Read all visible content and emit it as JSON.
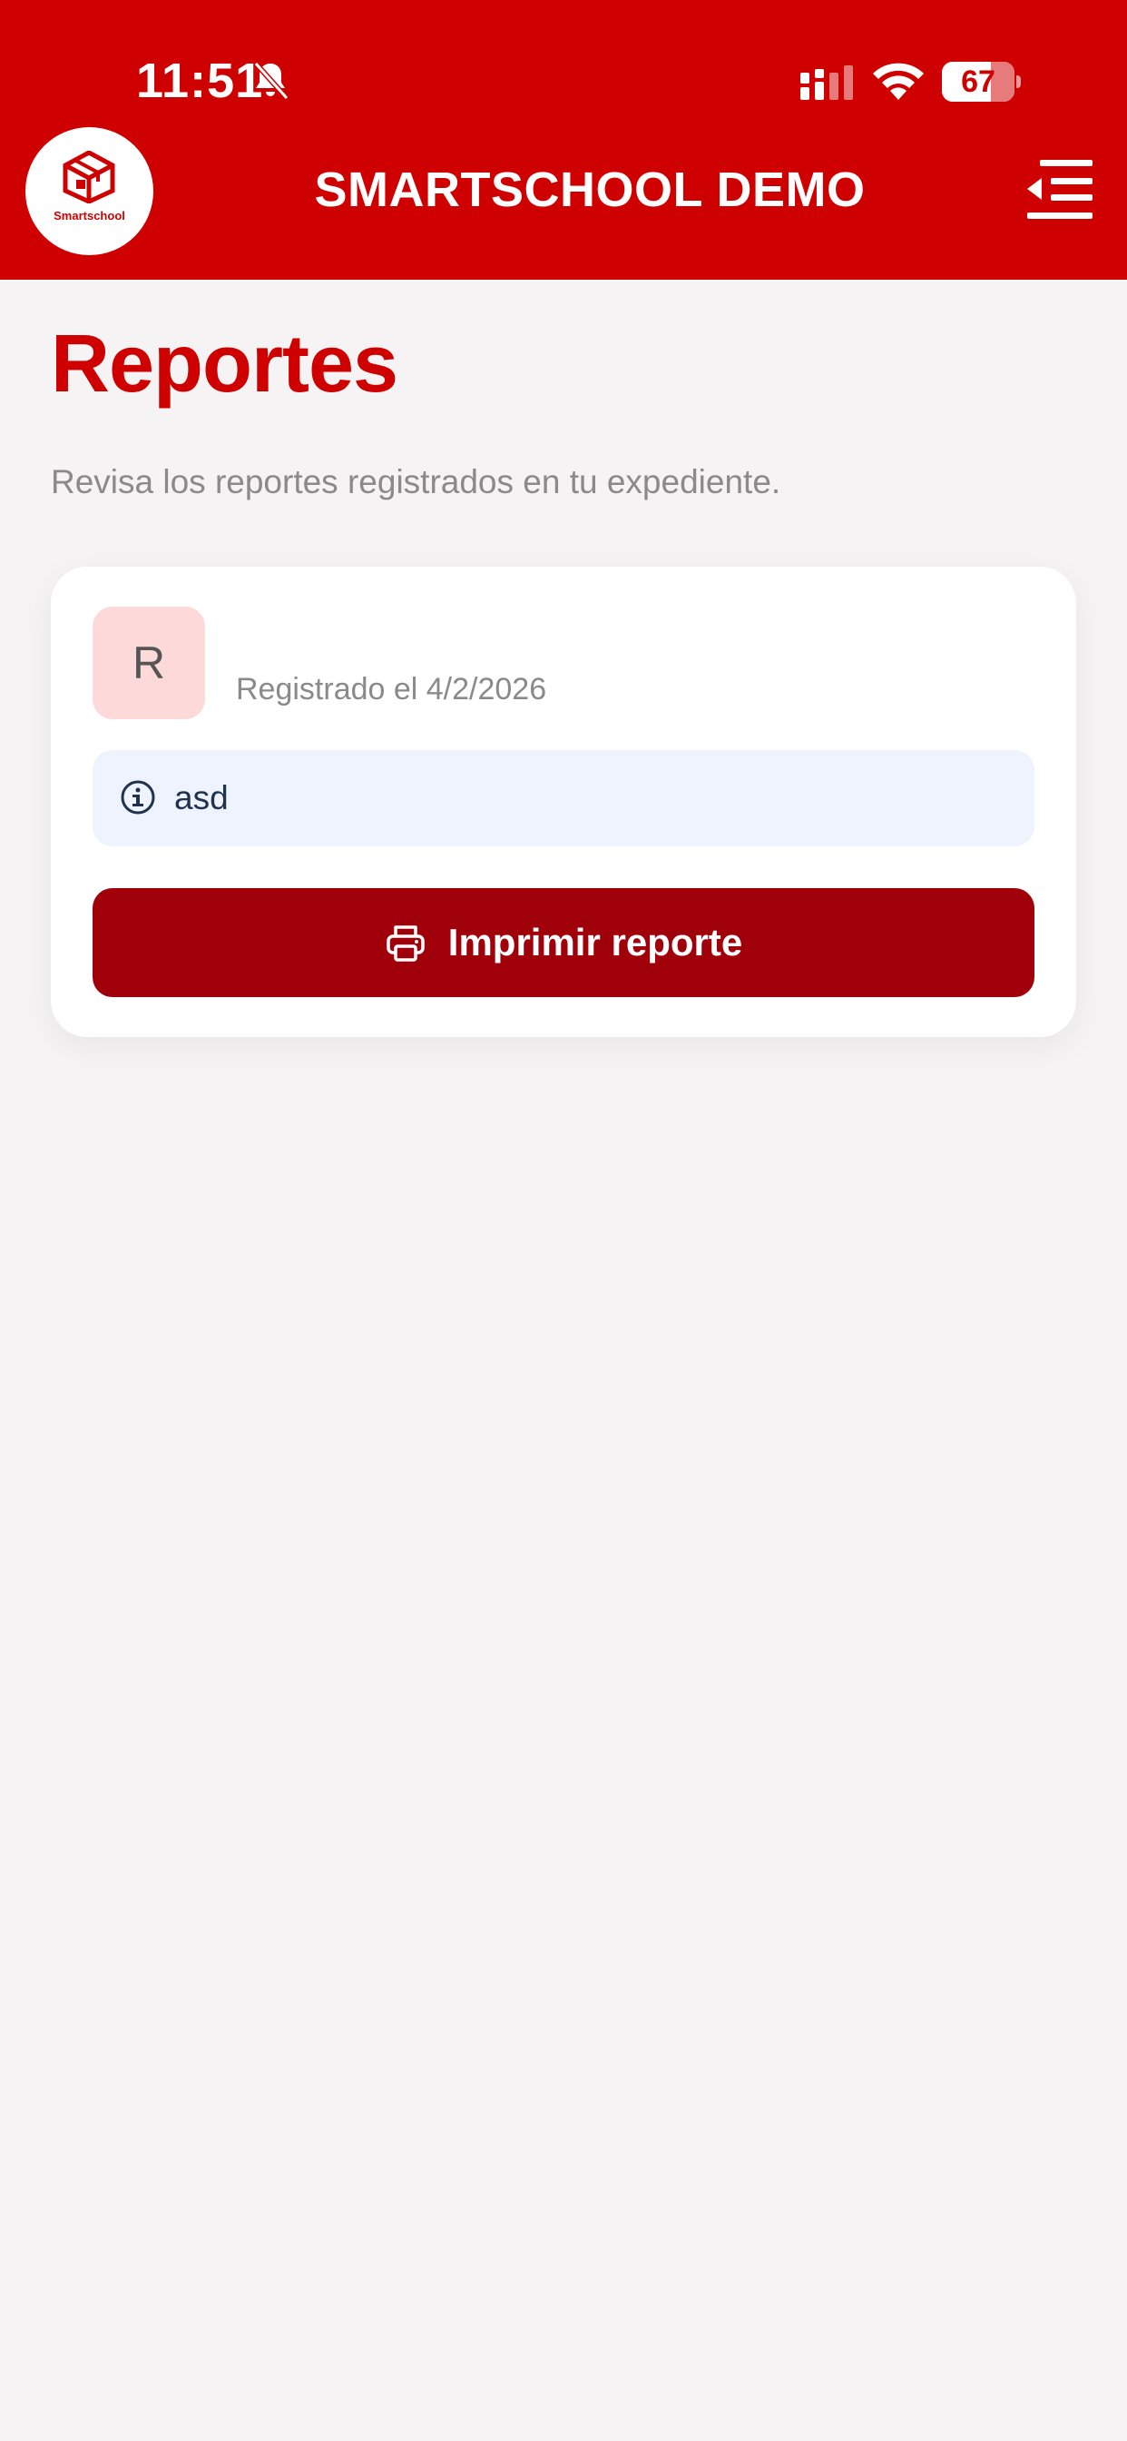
{
  "status_bar": {
    "time": "11:51",
    "battery_percent": 67,
    "battery_label": "67"
  },
  "header": {
    "logo_text": "Smartschool",
    "title": "SMARTSCHOOL DEMO"
  },
  "page": {
    "title": "Reportes",
    "subtitle": "Revisa los reportes registrados en tu expediente."
  },
  "report": {
    "avatar_letter": "R",
    "date_text": "Registrado el 4/2/2026",
    "info_text": "asd",
    "print_label": "Imprimir reporte"
  },
  "colors": {
    "header_red": "#cf0000",
    "button_dark_red": "#a0000a",
    "avatar_bg": "#fdd9d9",
    "info_bg": "#eef3fd",
    "background": "#f5f3f4"
  },
  "icons": {
    "bell": "bell-slash-icon",
    "signal": "cellular-signal-icon",
    "wifi": "wifi-icon",
    "battery": "battery-icon",
    "menu": "menu-collapse-icon",
    "info": "info-circle-icon",
    "printer": "printer-icon",
    "logo": "smartschool-logo-icon"
  }
}
